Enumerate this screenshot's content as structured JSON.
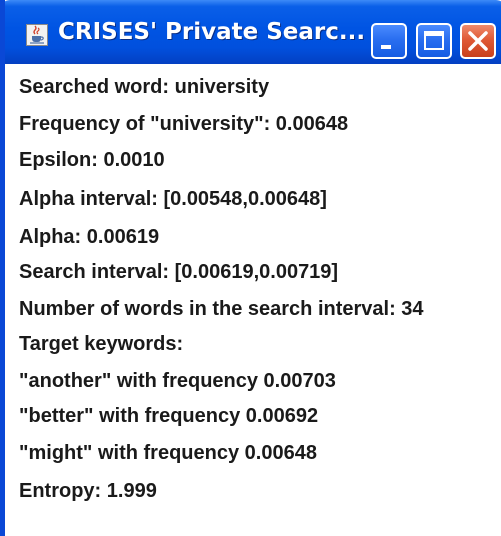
{
  "window": {
    "title": "CRISES' Private Searc...",
    "icon": "java-cup-icon",
    "buttons": {
      "minimize": "minimize-icon",
      "maximize": "maximize-icon",
      "close": "close-icon"
    },
    "colors": {
      "titlebar": "#0054e3",
      "close_button": "#e05a36",
      "frame_border": "#0a48d6"
    }
  },
  "info": {
    "searched_word": "Searched word: university",
    "frequency": "Frequency of \"university\": 0.00648",
    "epsilon": "Epsilon: 0.0010",
    "alpha_interval": "Alpha interval: [0.00548,0.00648]",
    "alpha": "Alpha: 0.00619",
    "search_interval": "Search interval: [0.00619,0.00719]",
    "words_in_interval": "Number of words in the search interval: 34",
    "target_keywords_label": "Target keywords:",
    "keywords": [
      "\"another\" with frequency 0.00703",
      "\"better\" with frequency 0.00692",
      "\"might\" with frequency 0.00648"
    ],
    "entropy": "Entropy: 1.999"
  }
}
